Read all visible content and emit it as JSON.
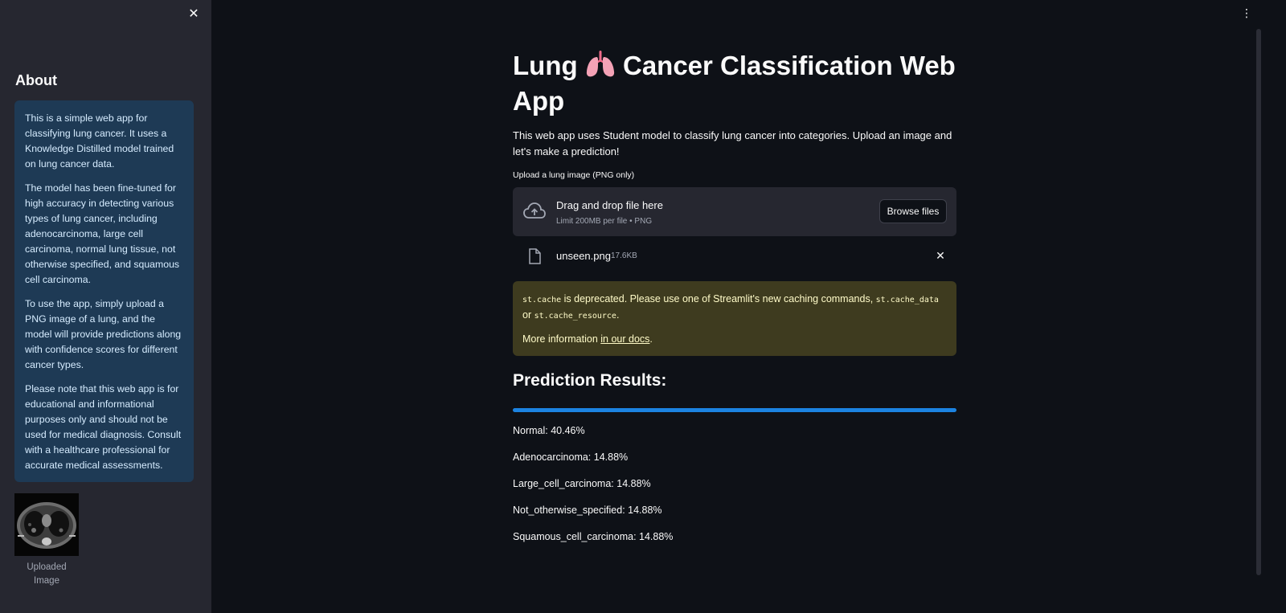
{
  "sidebar": {
    "about_title": "About",
    "about_paragraphs": [
      "This is a simple web app for classifying lung cancer. It uses a Knowledge Distilled model trained on lung cancer data.",
      "The model has been fine-tuned for high accuracy in detecting various types of lung cancer, including adenocarcinoma, large cell carcinoma, normal lung tissue, not otherwise specified, and squamous cell carcinoma.",
      "To use the app, simply upload a PNG image of a lung, and the model will provide predictions along with confidence scores for different cancer types.",
      "Please note that this web app is for educational and informational purposes only and should not be used for medical diagnosis. Consult with a healthcare professional for accurate medical assessments."
    ],
    "image_caption": "Uploaded Image",
    "close_icon": "close-icon"
  },
  "main": {
    "title_before": "Lung",
    "title_after": "Cancer Classification Web App",
    "title_icon": "lungs-icon",
    "intro": "This web app uses Student model to classify lung cancer into categories. Upload an image and let's make a prediction!",
    "uploader": {
      "label": "Upload a lung image (PNG only)",
      "drop_title": "Drag and drop file here",
      "limit": "Limit 200MB per file • PNG",
      "browse_label": "Browse files"
    },
    "file": {
      "name": "unseen.png",
      "size": "17.6KB"
    },
    "warning": {
      "code1": "st.cache",
      "text1": " is deprecated. Please use one of Streamlit's new caching commands, ",
      "code2": "st.cache_data",
      "text2": " or ",
      "code3": "st.cache_resource",
      "text3": ".",
      "more_prefix": "More information ",
      "link": "in our docs",
      "more_suffix": "."
    },
    "prediction_title": "Prediction Results:",
    "progress_value": 1.0,
    "results": [
      "Normal: 40.46%",
      "Adenocarcinoma: 14.88%",
      "Large_cell_carcinoma: 14.88%",
      "Not_otherwise_specified: 14.88%",
      "Squamous_cell_carcinoma: 14.88%"
    ]
  },
  "colors": {
    "background": "#0e1117",
    "sidebar": "#262730",
    "info_box": "#1e3a55",
    "warning_box": "#3e3b1f",
    "progress": "#1c83e1"
  }
}
